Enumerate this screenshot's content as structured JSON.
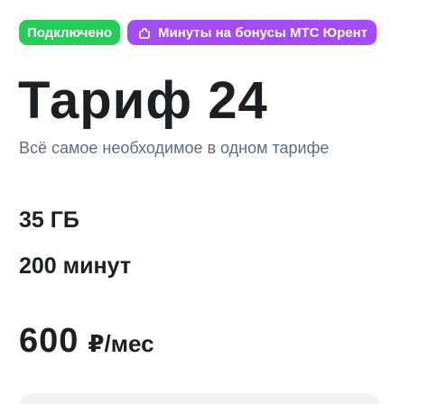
{
  "badges": {
    "connected_label": "Подключено",
    "bonus_label": "Минуты на бонусы МТС Юрент",
    "bonus_icon": "gift-icon"
  },
  "colors": {
    "connected_badge": "#26cd58",
    "bonus_badge": "#a54bf4",
    "subtitle_text": "#626c77",
    "primary_text": "#1d2023"
  },
  "tariff": {
    "title": "Тариф 24",
    "subtitle": "Всё самое необходимое в одном тарифе",
    "data_amount": "35 ГБ",
    "minutes_amount": "200 минут",
    "price_amount": "600",
    "price_unit": "₽/мес"
  }
}
